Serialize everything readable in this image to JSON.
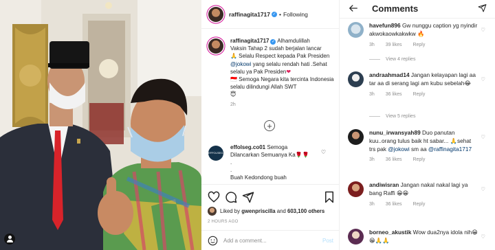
{
  "post": {
    "username": "raffinagita1717",
    "header_separator": "•",
    "follow_status": "Following",
    "caption_lines": [
      "Alhamdulillah",
      "Vaksin Tahap 2 sudah berjalan lancar",
      "🙏 Selalu Respect kepada Pak",
      "Presiden",
      "@jokowi",
      "yang selalu rendah",
      "hati .Sehat selalu ya Pak Presiden",
      "❤",
      "🇮🇩 Semoga Negara kita tercinta",
      "Indonesia selalu dilindungi Allah SWT",
      "😇"
    ],
    "time": "2h",
    "first_comment": {
      "avatar_text": "EFFOLSEG.CO",
      "username": "effolseg.co01",
      "text_line1": "Semoga",
      "text_line2": "Dilancarkan Semuanya Ka🌹🌹",
      "dot1": ".",
      "dot2": ".",
      "text_line3": "Buah Kedondong buah"
    },
    "likes_prefix": "Liked by",
    "liked_by": "gwenpriscilla",
    "likes_and": "and",
    "likes_count": "603,100 others",
    "date": "2 HOURS AGO",
    "add_comment_placeholder": "Add a comment...",
    "post_button": "Post"
  },
  "comments_panel": {
    "title": "Comments",
    "items": [
      {
        "username": "havefun896",
        "text": "Gw nunggu caption yg nyindir akwokaowkakwkw 🔥",
        "time": "3h",
        "likes": "39 likes",
        "reply": "Reply",
        "view_replies": "View 4 replies"
      },
      {
        "username": "andraahmad14",
        "text": "Jangan kelayapan lagi aa tar aa di serang lagi am kubu sebelah😂",
        "time": "3h",
        "likes": "36 likes",
        "reply": "Reply",
        "view_replies": "View 5 replies"
      },
      {
        "username": "nunu_irwansyah89",
        "text_before": "Duo panutan kuu..orang tulus baik ht sabar... 🙏sehat trs pak",
        "mention1": "@jokowi",
        "text_middle": "sm aa",
        "mention2": "@raffinagita1717",
        "time": "3h",
        "likes": "36 likes",
        "reply": "Reply"
      },
      {
        "username": "andiwisran",
        "text": "Jangan nakal nakal lagi ya bang Raffi 😁😁",
        "time": "3h",
        "likes": "36 likes",
        "reply": "Reply"
      },
      {
        "username": "borneo_akustik",
        "text": "Wow dua2nya idola nih😁😁🙏🙏",
        "time": "3h",
        "likes": "",
        "reply": ""
      }
    ]
  },
  "colors": {
    "link": "#00376b",
    "verified": "#3897f0",
    "muted": "#8e8e8e",
    "post_button": "#b2dffc",
    "border": "#efefef"
  },
  "icons": [
    "user-tag-icon",
    "heart-icon",
    "comment-icon",
    "share-icon",
    "bookmark-icon",
    "emoji-icon",
    "back-arrow-icon",
    "send-icon",
    "plus-circle-icon"
  ]
}
